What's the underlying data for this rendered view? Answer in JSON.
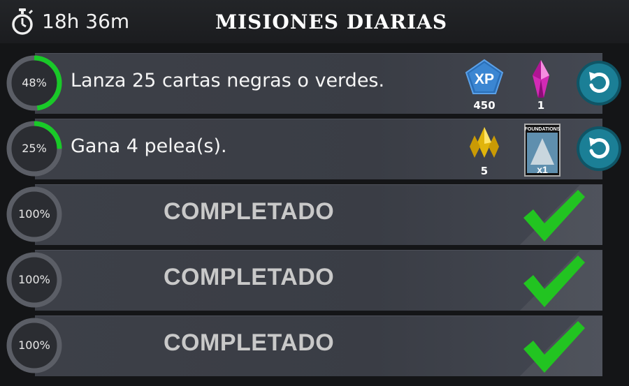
{
  "header": {
    "timer_icon": "stopwatch-icon",
    "timer_text": "18h 36m",
    "title": "MISIONES DIARIAS"
  },
  "colors": {
    "progress_green": "#19c928",
    "ring_grey": "#5b5e66",
    "check_green": "#22c421",
    "refresh_blue": "#1b7f96"
  },
  "missions": [
    {
      "progress_label": "48%",
      "progress": 0.48,
      "text": "Lanza 25 cartas negras o verdes.",
      "rewards": [
        {
          "icon": "xp-badge-icon",
          "badge_text": "XP",
          "count": "450"
        },
        {
          "icon": "pink-crystal-icon",
          "count": "1"
        }
      ],
      "refresh_icon": "refresh-icon"
    },
    {
      "progress_label": "25%",
      "progress": 0.25,
      "text": "Gana 4 pelea(s).",
      "rewards": [
        {
          "icon": "gold-crystal-icon",
          "count": "5"
        },
        {
          "icon": "card-pack-icon",
          "pack_name": "FOUNDATIONS",
          "count": "x1"
        }
      ],
      "refresh_icon": "refresh-icon"
    },
    {
      "progress_label": "100%",
      "progress": 1.0,
      "status": "COMPLETADO"
    },
    {
      "progress_label": "100%",
      "progress": 1.0,
      "status": "COMPLETADO"
    },
    {
      "progress_label": "100%",
      "progress": 1.0,
      "status": "COMPLETADO"
    }
  ]
}
